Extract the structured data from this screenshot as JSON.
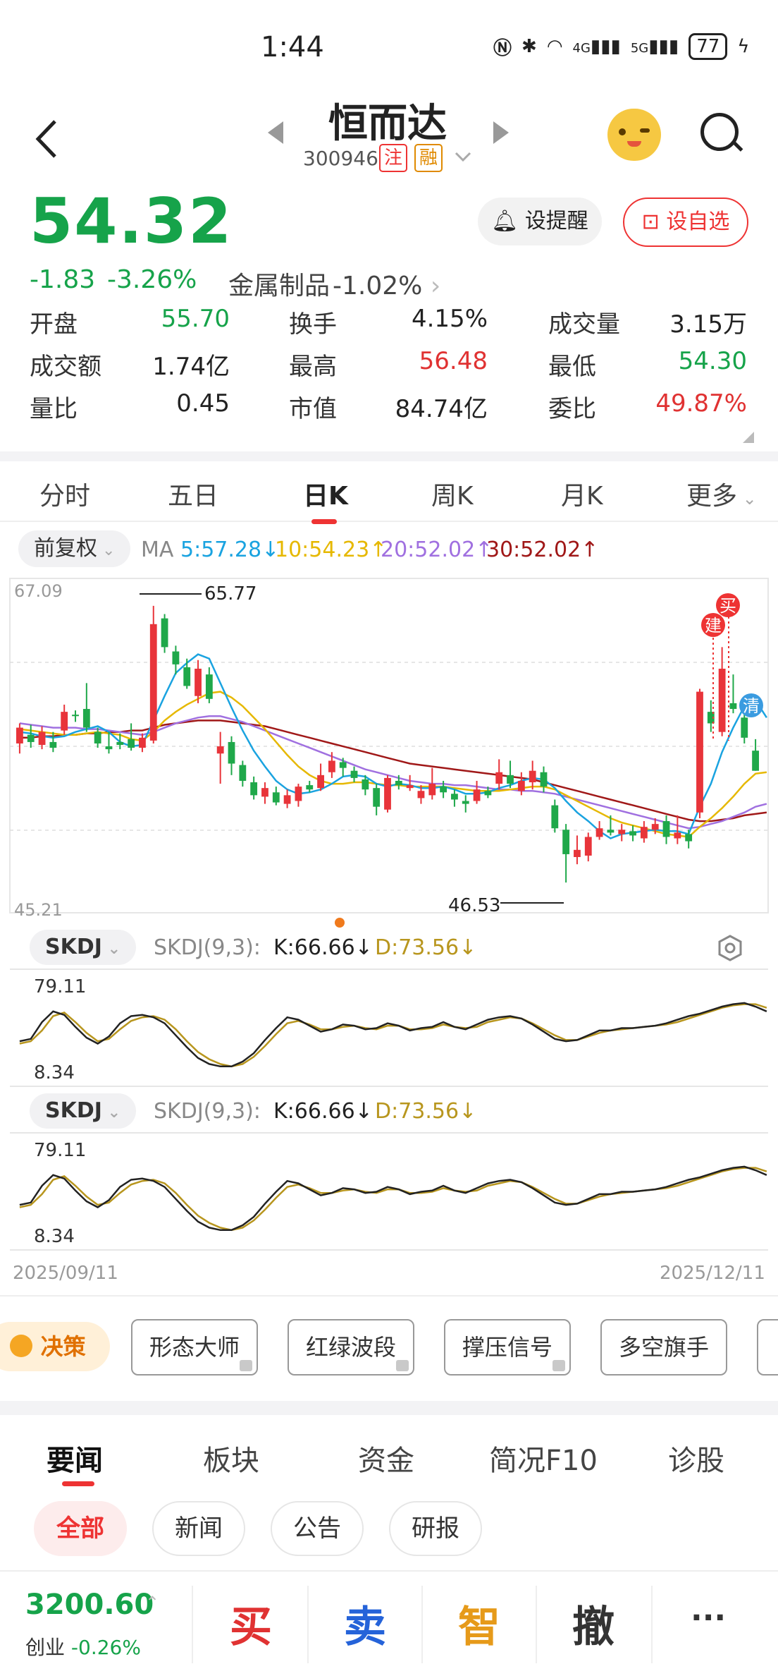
{
  "status": {
    "time": "1:44",
    "signal_labels": [
      "4G",
      "5G"
    ],
    "battery": "77"
  },
  "header": {
    "name": "恒而达",
    "code": "300946",
    "tag1": "注",
    "tag2": "融"
  },
  "quote": {
    "price": "54.32",
    "change": "-1.83",
    "change_pct": "-3.26%",
    "sector": "金属制品",
    "sector_pct": "-1.02%",
    "alert_btn": "设提醒",
    "watch_btn": "设自选"
  },
  "stats": [
    {
      "label": "开盘",
      "value": "55.70",
      "color": "green"
    },
    {
      "label": "换手",
      "value": "4.15%",
      "color": "black"
    },
    {
      "label": "成交量",
      "value": "3.15万",
      "color": "black"
    },
    {
      "label": "成交额",
      "value": "1.74亿",
      "color": "black"
    },
    {
      "label": "最高",
      "value": "56.48",
      "color": "red"
    },
    {
      "label": "最低",
      "value": "54.30",
      "color": "green"
    },
    {
      "label": "量比",
      "value": "0.45",
      "color": "black"
    },
    {
      "label": "市值",
      "value": "84.74亿",
      "color": "black"
    },
    {
      "label": "委比",
      "value": "49.87%",
      "color": "red"
    }
  ],
  "tabs": [
    "分时",
    "五日",
    "日K",
    "周K",
    "月K",
    "更多"
  ],
  "chart_toolbar": {
    "adjust": "前复权",
    "ma_label": "MA",
    "ma5": "5:57.28↓",
    "ma10": "10:54.23↑",
    "ma20": "20:52.02↑",
    "ma30": "30:52.02↑"
  },
  "indicator": {
    "name": "SKDJ",
    "params": "SKDJ(9,3):",
    "k": "K:66.66↓",
    "d": "D:73.56↓",
    "ymax": "79.11",
    "ymin": "8.34"
  },
  "chart_labels": {
    "buy": "买",
    "build": "建",
    "clear": "清",
    "date_start": "2025/09/11",
    "date_end": "2025/12/11"
  },
  "strategy": {
    "badge": "决策",
    "items": [
      "形态大师",
      "红绿波段",
      "撑压信号",
      "多空旗手"
    ]
  },
  "news": {
    "tabs": [
      "要闻",
      "板块",
      "资金",
      "简况F10",
      "诊股"
    ],
    "chips": [
      "全部",
      "新闻",
      "公告",
      "研报"
    ]
  },
  "bottom": {
    "index_value": "3200.60",
    "index_name": "创业",
    "index_pct": "-0.26%",
    "actions": [
      "买",
      "卖",
      "智",
      "撤",
      "···"
    ]
  },
  "chart_data": {
    "type": "candlestick",
    "ylim": [
      45.21,
      67.09
    ],
    "y_ticks": [
      "67.09",
      "45.21"
    ],
    "high_label": "65.77",
    "low_label": "46.53",
    "candles": [
      {
        "o": 56.2,
        "c": 57.3,
        "h": 57.6,
        "l": 55.5
      },
      {
        "o": 56.8,
        "c": 56.3,
        "h": 57.5,
        "l": 55.9
      },
      {
        "o": 56.1,
        "c": 57.0,
        "h": 57.4,
        "l": 55.8
      },
      {
        "o": 56.3,
        "c": 55.9,
        "h": 57.0,
        "l": 55.6
      },
      {
        "o": 57.1,
        "c": 58.4,
        "h": 58.9,
        "l": 56.8
      },
      {
        "o": 58.2,
        "c": 58.1,
        "h": 58.5,
        "l": 57.7
      },
      {
        "o": 58.6,
        "c": 57.3,
        "h": 60.4,
        "l": 57.0
      },
      {
        "o": 57.0,
        "c": 56.2,
        "h": 57.3,
        "l": 55.9
      },
      {
        "o": 56.0,
        "c": 55.8,
        "h": 57.0,
        "l": 55.5
      },
      {
        "o": 56.3,
        "c": 56.1,
        "h": 56.9,
        "l": 55.8
      },
      {
        "o": 56.5,
        "c": 55.9,
        "h": 57.6,
        "l": 55.7
      },
      {
        "o": 55.9,
        "c": 56.6,
        "h": 56.9,
        "l": 55.6
      },
      {
        "o": 56.4,
        "c": 64.5,
        "h": 65.77,
        "l": 56.2
      },
      {
        "o": 64.9,
        "c": 62.9,
        "h": 65.2,
        "l": 62.5
      },
      {
        "o": 62.6,
        "c": 61.7,
        "h": 63.0,
        "l": 61.0
      },
      {
        "o": 61.5,
        "c": 60.2,
        "h": 62.1,
        "l": 60.0
      },
      {
        "o": 59.5,
        "c": 61.4,
        "h": 62.0,
        "l": 59.0
      },
      {
        "o": 61.0,
        "c": 59.3,
        "h": 61.5,
        "l": 59.0
      },
      {
        "o": 55.5,
        "c": 56.0,
        "h": 57.0,
        "l": 53.4
      },
      {
        "o": 56.3,
        "c": 54.8,
        "h": 56.7,
        "l": 54.0
      },
      {
        "o": 54.7,
        "c": 53.6,
        "h": 55.0,
        "l": 53.2
      },
      {
        "o": 53.5,
        "c": 52.6,
        "h": 53.9,
        "l": 52.3
      },
      {
        "o": 52.5,
        "c": 53.1,
        "h": 53.5,
        "l": 52.0
      },
      {
        "o": 52.8,
        "c": 52.1,
        "h": 53.2,
        "l": 51.9
      },
      {
        "o": 52.0,
        "c": 52.6,
        "h": 53.0,
        "l": 51.7
      },
      {
        "o": 52.2,
        "c": 53.2,
        "h": 53.4,
        "l": 51.8
      },
      {
        "o": 53.3,
        "c": 53.0,
        "h": 53.6,
        "l": 52.8
      },
      {
        "o": 53.1,
        "c": 54.0,
        "h": 54.8,
        "l": 52.9
      },
      {
        "o": 54.2,
        "c": 55.0,
        "h": 55.6,
        "l": 53.8
      },
      {
        "o": 54.9,
        "c": 54.5,
        "h": 55.2,
        "l": 53.9
      },
      {
        "o": 54.3,
        "c": 53.8,
        "h": 54.6,
        "l": 53.5
      },
      {
        "o": 53.7,
        "c": 53.0,
        "h": 54.0,
        "l": 52.6
      },
      {
        "o": 53.1,
        "c": 51.8,
        "h": 53.4,
        "l": 51.2
      },
      {
        "o": 51.6,
        "c": 53.8,
        "h": 54.0,
        "l": 51.4
      },
      {
        "o": 53.6,
        "c": 53.3,
        "h": 54.0,
        "l": 53.0
      },
      {
        "o": 53.1,
        "c": 53.3,
        "h": 54.0,
        "l": 52.9
      },
      {
        "o": 52.4,
        "c": 52.9,
        "h": 53.3,
        "l": 52.0
      },
      {
        "o": 52.6,
        "c": 53.4,
        "h": 54.5,
        "l": 52.3
      },
      {
        "o": 53.2,
        "c": 52.8,
        "h": 53.6,
        "l": 52.4
      },
      {
        "o": 52.7,
        "c": 52.3,
        "h": 53.0,
        "l": 51.8
      },
      {
        "o": 52.2,
        "c": 52.0,
        "h": 52.6,
        "l": 51.4
      },
      {
        "o": 52.2,
        "c": 53.0,
        "h": 53.6,
        "l": 52.0
      },
      {
        "o": 52.9,
        "c": 52.6,
        "h": 53.2,
        "l": 52.4
      },
      {
        "o": 53.4,
        "c": 54.2,
        "h": 55.1,
        "l": 53.0
      },
      {
        "o": 54.0,
        "c": 53.4,
        "h": 55.0,
        "l": 53.1
      },
      {
        "o": 52.9,
        "c": 53.6,
        "h": 54.2,
        "l": 52.6
      },
      {
        "o": 53.5,
        "c": 54.3,
        "h": 55.0,
        "l": 53.0
      },
      {
        "o": 54.2,
        "c": 53.2,
        "h": 54.6,
        "l": 52.8
      },
      {
        "o": 51.9,
        "c": 50.3,
        "h": 52.3,
        "l": 50.0
      },
      {
        "o": 50.2,
        "c": 48.5,
        "h": 50.6,
        "l": 46.53
      },
      {
        "o": 48.3,
        "c": 48.8,
        "h": 49.8,
        "l": 47.8
      },
      {
        "o": 48.4,
        "c": 49.7,
        "h": 50.0,
        "l": 48.0
      },
      {
        "o": 49.7,
        "c": 50.3,
        "h": 50.8,
        "l": 49.5
      },
      {
        "o": 50.2,
        "c": 50.0,
        "h": 51.2,
        "l": 49.8
      },
      {
        "o": 49.9,
        "c": 50.2,
        "h": 50.6,
        "l": 49.4
      },
      {
        "o": 50.1,
        "c": 49.8,
        "h": 50.5,
        "l": 49.4
      },
      {
        "o": 49.6,
        "c": 50.4,
        "h": 50.8,
        "l": 49.3
      },
      {
        "o": 50.2,
        "c": 50.6,
        "h": 51.0,
        "l": 49.9
      },
      {
        "o": 50.8,
        "c": 49.7,
        "h": 51.2,
        "l": 49.2
      },
      {
        "o": 49.6,
        "c": 50.0,
        "h": 51.2,
        "l": 49.2
      },
      {
        "o": 49.9,
        "c": 49.4,
        "h": 50.2,
        "l": 48.9
      },
      {
        "o": 51.4,
        "c": 59.8,
        "h": 60.0,
        "l": 51.0
      },
      {
        "o": 58.4,
        "c": 57.6,
        "h": 59.2,
        "l": 57.0
      },
      {
        "o": 57.0,
        "c": 61.4,
        "h": 62.9,
        "l": 56.7
      },
      {
        "o": 59.0,
        "c": 58.6,
        "h": 61.0,
        "l": 58.3
      },
      {
        "o": 58.0,
        "c": 56.6,
        "h": 58.5,
        "l": 56.2
      },
      {
        "o": 55.7,
        "c": 54.3,
        "h": 56.5,
        "l": 54.3
      }
    ],
    "skdj_k": [
      46,
      48,
      62,
      71,
      68,
      58,
      49,
      44,
      50,
      61,
      67,
      68,
      66,
      61,
      51,
      41,
      32,
      27,
      25,
      25,
      29,
      36,
      47,
      57,
      66,
      64,
      59,
      54,
      56,
      60,
      59,
      56,
      57,
      61,
      59,
      55,
      57,
      58,
      62,
      58,
      56,
      60,
      64,
      66,
      67,
      65,
      60,
      54,
      48,
      46,
      47,
      51,
      55,
      55,
      57,
      57,
      58,
      59,
      61,
      64,
      67,
      69,
      72,
      75,
      77,
      78,
      75,
      71
    ],
    "skdj_d": [
      44,
      46,
      55,
      67,
      70,
      62,
      53,
      46,
      48,
      56,
      63,
      66,
      67,
      64,
      56,
      46,
      37,
      31,
      27,
      25,
      27,
      33,
      42,
      52,
      61,
      63,
      60,
      56,
      56,
      58,
      59,
      57,
      56,
      59,
      59,
      56,
      56,
      57,
      60,
      58,
      57,
      58,
      62,
      64,
      66,
      65,
      61,
      56,
      51,
      47,
      47,
      50,
      53,
      55,
      56,
      57,
      58,
      59,
      60,
      62,
      65,
      68,
      71,
      74,
      76,
      77,
      77,
      74
    ],
    "ma5": [
      57.0,
      56.9,
      56.7,
      56.6,
      56.7,
      57.0,
      57.2,
      57.4,
      57.0,
      56.3,
      56.0,
      56.1,
      57.8,
      59.5,
      61.1,
      61.8,
      62.4,
      62.1,
      60.4,
      58.7,
      57.1,
      55.7,
      54.6,
      53.6,
      53.0,
      52.7,
      52.8,
      53.0,
      53.4,
      53.9,
      54.0,
      53.9,
      53.4,
      53.2,
      53.4,
      53.3,
      53.1,
      53.1,
      53.2,
      53.0,
      52.7,
      52.7,
      52.8,
      53.1,
      53.3,
      53.6,
      53.8,
      53.7,
      53.1,
      52.2,
      51.4,
      50.8,
      50.1,
      49.6,
      49.9,
      50.0,
      50.1,
      50.2,
      50.1,
      50.1,
      49.9,
      51.8,
      53.4,
      55.6,
      57.3,
      58.8,
      59.2,
      58.0
    ],
    "ma10": [
      57.2,
      57.1,
      57.0,
      56.9,
      56.8,
      56.8,
      56.9,
      57.0,
      56.9,
      56.8,
      56.5,
      56.4,
      57.0,
      57.8,
      58.4,
      58.9,
      59.3,
      59.7,
      59.8,
      59.4,
      58.8,
      58.0,
      57.2,
      56.3,
      55.4,
      54.6,
      54.0,
      53.6,
      53.4,
      53.4,
      53.5,
      53.5,
      53.4,
      53.3,
      53.3,
      53.2,
      53.2,
      53.2,
      53.2,
      53.1,
      53.0,
      52.9,
      52.9,
      52.9,
      53.0,
      53.1,
      53.2,
      53.2,
      53.0,
      52.6,
      52.2,
      51.8,
      51.4,
      51.0,
      50.7,
      50.5,
      50.3,
      50.1,
      49.9,
      49.8,
      49.7,
      50.4,
      51.0,
      51.7,
      52.5,
      53.4,
      54.1,
      54.2
    ],
    "ma20": [
      57.6,
      57.5,
      57.4,
      57.3,
      57.3,
      57.3,
      57.2,
      57.2,
      57.1,
      57.0,
      56.9,
      56.8,
      57.0,
      57.3,
      57.6,
      57.8,
      58.0,
      58.1,
      58.1,
      57.9,
      57.7,
      57.4,
      57.1,
      56.8,
      56.5,
      56.2,
      55.9,
      55.6,
      55.3,
      55.0,
      54.7,
      54.4,
      54.2,
      54.0,
      53.8,
      53.6,
      53.5,
      53.4,
      53.4,
      53.3,
      53.3,
      53.2,
      53.1,
      53.0,
      53.0,
      52.9,
      52.9,
      52.8,
      52.7,
      52.5,
      52.3,
      52.1,
      51.9,
      51.7,
      51.5,
      51.3,
      51.1,
      50.9,
      50.7,
      50.5,
      50.3,
      50.4,
      50.6,
      50.8,
      51.1,
      51.4,
      51.8,
      52.0
    ],
    "ma30": [
      56.6,
      56.6,
      56.7,
      56.7,
      56.8,
      56.8,
      56.9,
      56.9,
      57.0,
      57.0,
      57.1,
      57.1,
      57.3,
      57.5,
      57.6,
      57.7,
      57.8,
      57.8,
      57.8,
      57.7,
      57.6,
      57.5,
      57.4,
      57.2,
      57.0,
      56.8,
      56.6,
      56.4,
      56.2,
      56.0,
      55.8,
      55.6,
      55.4,
      55.2,
      55.0,
      54.8,
      54.7,
      54.6,
      54.5,
      54.4,
      54.3,
      54.2,
      54.1,
      54.0,
      53.9,
      53.8,
      53.7,
      53.5,
      53.3,
      53.1,
      52.9,
      52.7,
      52.5,
      52.3,
      52.1,
      51.9,
      51.7,
      51.5,
      51.3,
      51.1,
      50.9,
      50.8,
      50.8,
      50.9,
      51.0,
      51.2,
      51.3,
      51.4
    ]
  }
}
